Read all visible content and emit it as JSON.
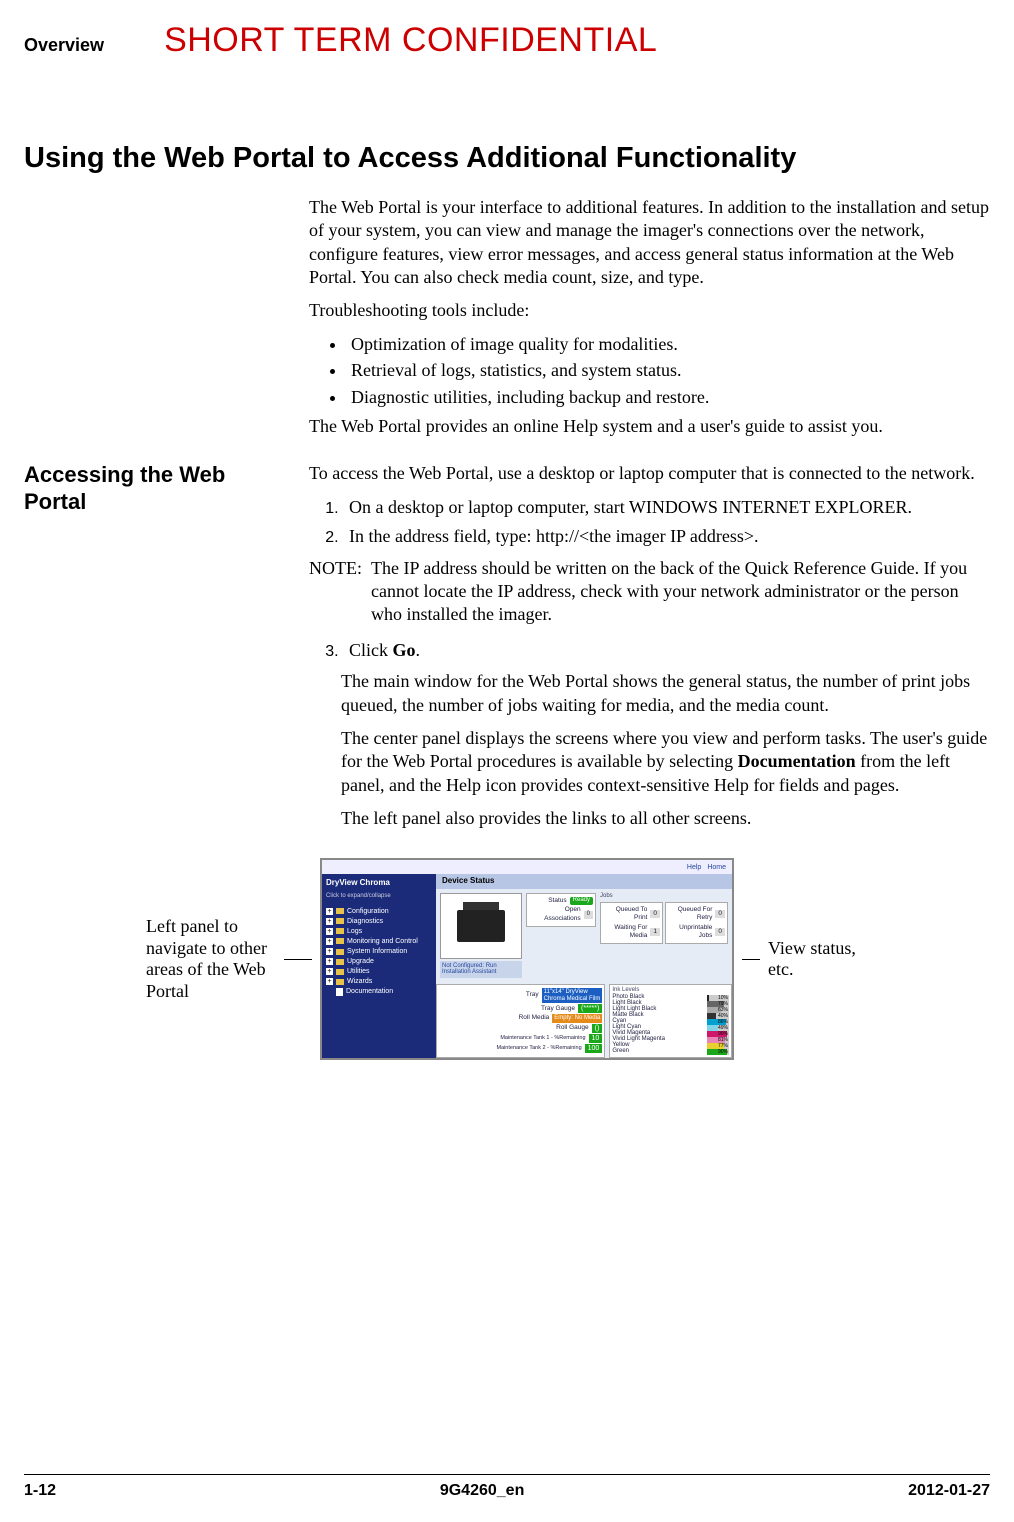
{
  "header": {
    "section": "Overview",
    "watermark": "SHORT TERM CONFIDENTIAL"
  },
  "title": "Using the Web Portal to Access Additional Functionality",
  "intro1": "The Web Portal is your interface to additional features. In addition to the installation and setup of your system, you can view and manage the imager's connections over the network, configure features, view error messages, and access general status information at the Web Portal. You can also check media count, size, and type.",
  "intro2": "Troubleshooting tools include:",
  "bullets": [
    "Optimization of image quality for modalities.",
    "Retrieval of logs, statistics, and system status.",
    "Diagnostic utilities, including backup and restore."
  ],
  "intro3": "The Web Portal provides an online Help system and a user's guide to assist you.",
  "subhead": "Accessing the Web Portal",
  "access_intro": "To access the Web Portal, use a desktop or laptop computer that is connected to the network.",
  "step1": "On a desktop or laptop computer, start WINDOWS INTERNET EXPLORER.",
  "step2": "In the address field, type: http://<the imager IP address>.",
  "note_label": "NOTE:",
  "note_body": "The IP address should be written on the back of the Quick Reference Guide. If you cannot locate the IP address, check with your network administrator or the person who installed the imager.",
  "step3_pre": "Click ",
  "step3_bold": "Go",
  "step3_post": ".",
  "step3_p1": "The main window for the Web Portal shows the general status, the number of print jobs queued, the number of jobs waiting for media, and the media count.",
  "step3_p2a": "The center panel displays the screens where you view and perform tasks. The user's guide for the Web Portal procedures is available by selecting ",
  "step3_p2bold": "Documentation",
  "step3_p2b": " from the left panel, and the Help icon provides context-sensitive Help for fields and pages.",
  "step3_p3": "The left panel also provides the links to all other screens.",
  "callout_left": "Left panel to navigate to other areas of the Web Portal",
  "callout_right": "View status, etc.",
  "screenshot": {
    "help": "Help",
    "home": "Home",
    "brand": "DryView Chroma",
    "click": "Click to expand/collapse",
    "nav": [
      "Configuration",
      "Diagnostics",
      "Logs",
      "Monitoring and Control",
      "System Information",
      "Upgrade",
      "Utilities",
      "Wizards",
      "Documentation"
    ],
    "panel_title": "Device Status",
    "status_label": "Status",
    "status_val": "Ready",
    "open_label": "Open Associations",
    "open_val": "0",
    "config_msg": "Not Configured: Run Installation Assistant",
    "jobs_title": "Jobs",
    "q_print": "Queued To Print",
    "q_print_v": "0",
    "wait_media": "Waiting For Media",
    "wait_media_v": "1",
    "q_retry": "Queued For Retry",
    "q_retry_v": "0",
    "unprint": "Unprintable Jobs",
    "unprint_v": "0",
    "tray": "Tray",
    "tray_val1": "11\"x14\" DryView",
    "tray_val2": "Chroma Medical Film",
    "tray_gauge": "Tray Gauge",
    "tray_gauge_v": "(*****)",
    "roll_media": "Roll Media",
    "roll_media_v": "Empty: No Media",
    "roll_gauge": "Roll Gauge",
    "roll_gauge_v": "()",
    "maint1": "Maintenance Tank 1 - %Remaining",
    "maint1_v": "10",
    "maint2": "Maintenance Tank 2 - %Remaining",
    "maint2_v": "100",
    "ink_title": "Ink Levels",
    "inks": [
      {
        "n": "Photo Black",
        "v": "10%",
        "c": "#222"
      },
      {
        "n": "Light Black",
        "v": "79%",
        "c": "#666"
      },
      {
        "n": "Light Light Black",
        "v": "63%",
        "c": "#aaa"
      },
      {
        "n": "Matte Black",
        "v": "40%",
        "c": "#333"
      },
      {
        "n": "Cyan",
        "v": "86%",
        "c": "#00a0d0"
      },
      {
        "n": "Light Cyan",
        "v": "49%",
        "c": "#7fd4e8"
      },
      {
        "n": "Vivid Magenta",
        "v": "90%",
        "c": "#d0186a"
      },
      {
        "n": "Vivid Light Magenta",
        "v": "81%",
        "c": "#e884b6"
      },
      {
        "n": "Yellow",
        "v": "77%",
        "c": "#e8d030"
      },
      {
        "n": "Green",
        "v": "90%",
        "c": "#1aa81a"
      }
    ]
  },
  "footer": {
    "left": "1-12",
    "center": "9G4260_en",
    "right": "2012-01-27"
  }
}
